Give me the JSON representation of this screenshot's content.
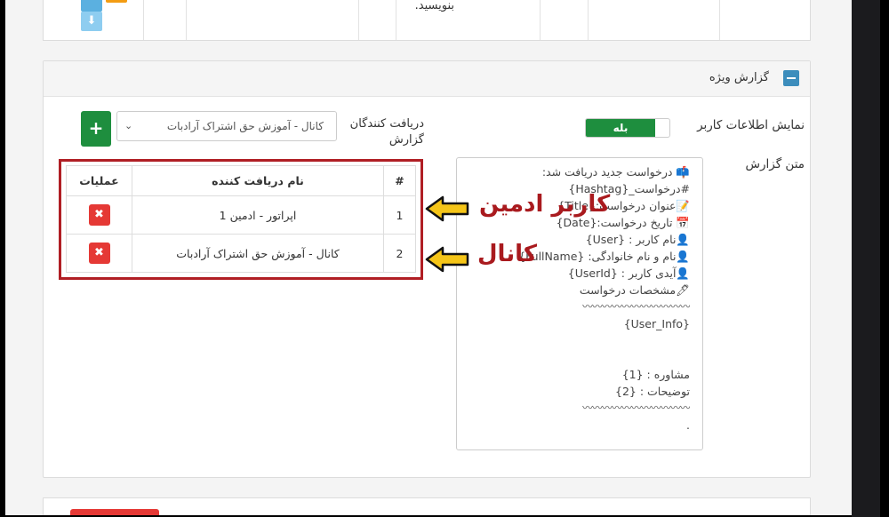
{
  "top_panel": {
    "text_fragment": "بنویسید."
  },
  "special_report": {
    "title": "گزارش ویژه",
    "show_user_info": {
      "label": "نمایش اطلاعات کاربر",
      "toggle_value": "بله"
    },
    "receivers": {
      "label_line1": "دریافت کنندگان",
      "label_line2": "گزارش",
      "selected": "کانال - آموزش حق اشتراک آرادبات",
      "add_label": "+"
    },
    "report_text": {
      "label": "متن گزارش",
      "lines": [
        "📫 درخواست جدید دریافت شد:",
        "#درخواست_{Hashtag}",
        "📝عنوان درخواست:{Title}",
        "📅 تاریخ درخواست:{Date}",
        "👤نام کاربر : {User}",
        "👤نام و نام خانوادگی: {FullName}",
        "👤آیدی کاربر : {UserId}",
        "🖊مشخصات درخواست",
        "〰〰〰〰〰〰〰〰〰〰〰",
        "{User_Info}",
        "",
        "",
        "مشاوره : {1}",
        "توضیحات : {2}",
        "〰〰〰〰〰〰〰〰〰〰〰",
        "."
      ]
    },
    "table": {
      "headers": [
        "#",
        "نام دریافت کننده",
        "عملیات"
      ],
      "rows": [
        {
          "num": "1",
          "name": "اپراتور - ادمین 1",
          "action": "✖"
        },
        {
          "num": "2",
          "name": "کانال - آموزش حق اشتراک آرادبات",
          "action": "✖"
        }
      ]
    }
  },
  "annotations": {
    "admin_user": "کاربر ادمین",
    "channel": "کانال"
  },
  "colors": {
    "green": "#1e8e3e",
    "red": "#e53935",
    "annotation_red": "#a91a1e",
    "arrow_yellow": "#f5c518",
    "primary_blue": "#3c8dbc"
  }
}
